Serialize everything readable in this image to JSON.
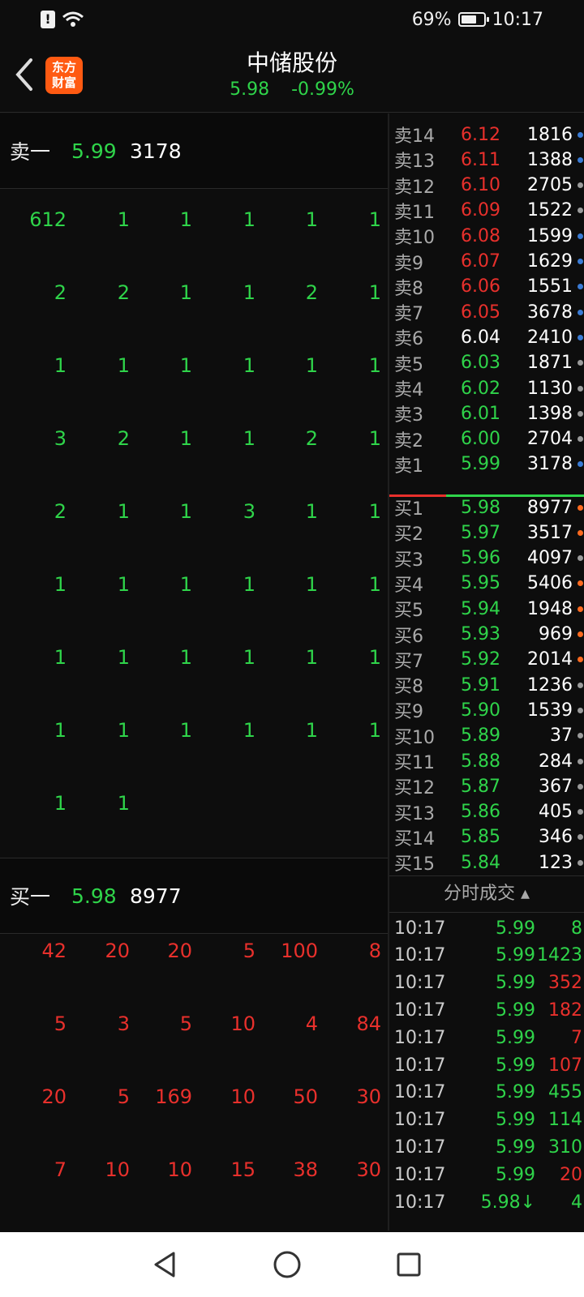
{
  "status": {
    "battery": "69%",
    "time": "10:17"
  },
  "header": {
    "title": "中储股份",
    "price": "5.98",
    "change": "-0.99%",
    "logo_top": "东方",
    "logo_bottom": "财富"
  },
  "sell1": {
    "label": "卖一",
    "price": "5.99",
    "volume": "3178"
  },
  "buy1": {
    "label": "买一",
    "price": "5.98",
    "volume": "8977"
  },
  "sell_queue": [
    [
      "612",
      "1",
      "1",
      "1",
      "1",
      "1"
    ],
    [
      "2",
      "2",
      "1",
      "1",
      "2",
      "1"
    ],
    [
      "1",
      "1",
      "1",
      "1",
      "1",
      "1"
    ],
    [
      "3",
      "2",
      "1",
      "1",
      "2",
      "1"
    ],
    [
      "2",
      "1",
      "1",
      "3",
      "1",
      "1"
    ],
    [
      "1",
      "1",
      "1",
      "1",
      "1",
      "1"
    ],
    [
      "1",
      "1",
      "1",
      "1",
      "1",
      "1"
    ],
    [
      "1",
      "1",
      "1",
      "1",
      "1",
      "1"
    ],
    [
      "1",
      "1"
    ]
  ],
  "buy_queue": [
    [
      "42",
      "20",
      "20",
      "5",
      "100",
      "8"
    ],
    [
      "5",
      "3",
      "5",
      "10",
      "4",
      "84"
    ],
    [
      "20",
      "5",
      "169",
      "10",
      "50",
      "30"
    ],
    [
      "7",
      "10",
      "10",
      "15",
      "38",
      "30"
    ]
  ],
  "ask_levels": [
    {
      "label": "卖14",
      "price": "6.12",
      "volume": "1816",
      "price_color": "red",
      "dot": "blue"
    },
    {
      "label": "卖13",
      "price": "6.11",
      "volume": "1388",
      "price_color": "red",
      "dot": "blue"
    },
    {
      "label": "卖12",
      "price": "6.10",
      "volume": "2705",
      "price_color": "red",
      "dot": "gray"
    },
    {
      "label": "卖11",
      "price": "6.09",
      "volume": "1522",
      "price_color": "red",
      "dot": "gray"
    },
    {
      "label": "卖10",
      "price": "6.08",
      "volume": "1599",
      "price_color": "red",
      "dot": "blue"
    },
    {
      "label": "卖9",
      "price": "6.07",
      "volume": "1629",
      "price_color": "red",
      "dot": "blue"
    },
    {
      "label": "卖8",
      "price": "6.06",
      "volume": "1551",
      "price_color": "red",
      "dot": "blue"
    },
    {
      "label": "卖7",
      "price": "6.05",
      "volume": "3678",
      "price_color": "red",
      "dot": "blue"
    },
    {
      "label": "卖6",
      "price": "6.04",
      "volume": "2410",
      "price_color": "white",
      "dot": "blue"
    },
    {
      "label": "卖5",
      "price": "6.03",
      "volume": "1871",
      "price_color": "green",
      "dot": "gray"
    },
    {
      "label": "卖4",
      "price": "6.02",
      "volume": "1130",
      "price_color": "green",
      "dot": "gray"
    },
    {
      "label": "卖3",
      "price": "6.01",
      "volume": "1398",
      "price_color": "green",
      "dot": "gray"
    },
    {
      "label": "卖2",
      "price": "6.00",
      "volume": "2704",
      "price_color": "green",
      "dot": "gray"
    },
    {
      "label": "卖1",
      "price": "5.99",
      "volume": "3178",
      "price_color": "green",
      "dot": "blue"
    }
  ],
  "bid_levels": [
    {
      "label": "买1",
      "price": "5.98",
      "volume": "8977",
      "dot": "orange"
    },
    {
      "label": "买2",
      "price": "5.97",
      "volume": "3517",
      "dot": "orange"
    },
    {
      "label": "买3",
      "price": "5.96",
      "volume": "4097",
      "dot": "gray"
    },
    {
      "label": "买4",
      "price": "5.95",
      "volume": "5406",
      "dot": "orange"
    },
    {
      "label": "买5",
      "price": "5.94",
      "volume": "1948",
      "dot": "orange"
    },
    {
      "label": "买6",
      "price": "5.93",
      "volume": "969",
      "dot": "orange"
    },
    {
      "label": "买7",
      "price": "5.92",
      "volume": "2014",
      "dot": "orange"
    },
    {
      "label": "买8",
      "price": "5.91",
      "volume": "1236",
      "dot": "gray"
    },
    {
      "label": "买9",
      "price": "5.90",
      "volume": "1539",
      "dot": "gray"
    },
    {
      "label": "买10",
      "price": "5.89",
      "volume": "37",
      "dot": "gray"
    },
    {
      "label": "买11",
      "price": "5.88",
      "volume": "284",
      "dot": "gray"
    },
    {
      "label": "买12",
      "price": "5.87",
      "volume": "367",
      "dot": "gray"
    },
    {
      "label": "买13",
      "price": "5.86",
      "volume": "405",
      "dot": "gray"
    },
    {
      "label": "买14",
      "price": "5.85",
      "volume": "346",
      "dot": "gray"
    },
    {
      "label": "买15",
      "price": "5.84",
      "volume": "123",
      "dot": "gray"
    }
  ],
  "ticks_header": "分时成交 ▴",
  "ticks": [
    {
      "time": "10:17",
      "price": "5.99",
      "volume": "8",
      "vol_color": "green"
    },
    {
      "time": "10:17",
      "price": "5.99",
      "volume": "1423",
      "vol_color": "green"
    },
    {
      "time": "10:17",
      "price": "5.99",
      "volume": "352",
      "vol_color": "red"
    },
    {
      "time": "10:17",
      "price": "5.99",
      "volume": "182",
      "vol_color": "red"
    },
    {
      "time": "10:17",
      "price": "5.99",
      "volume": "7",
      "vol_color": "red"
    },
    {
      "time": "10:17",
      "price": "5.99",
      "volume": "107",
      "vol_color": "red"
    },
    {
      "time": "10:17",
      "price": "5.99",
      "volume": "455",
      "vol_color": "green"
    },
    {
      "time": "10:17",
      "price": "5.99",
      "volume": "114",
      "vol_color": "green"
    },
    {
      "time": "10:17",
      "price": "5.99",
      "volume": "310",
      "vol_color": "green"
    },
    {
      "time": "10:17",
      "price": "5.99",
      "volume": "20",
      "vol_color": "red"
    },
    {
      "time": "10:17",
      "price": "5.98↓",
      "volume": "4",
      "vol_color": "green"
    }
  ]
}
